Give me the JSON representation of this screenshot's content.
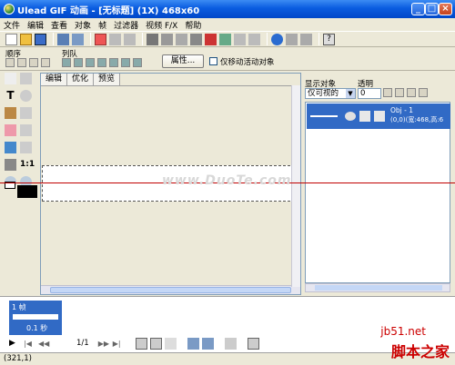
{
  "window": {
    "title": "Ulead GIF 动画 - [无标题] (1X) 468x60"
  },
  "menu": [
    "文件",
    "编辑",
    "查看",
    "对象",
    "帧",
    "过滤器",
    "视频 F/X",
    "帮助"
  ],
  "toolbar2": {
    "order_label": "顺序",
    "queue_label": "列队",
    "properties_button": "属性...",
    "move_active_only": "仅移动活动对象"
  },
  "canvas_tabs": [
    "编辑",
    "优化",
    "预览"
  ],
  "watermark": "www.DuoTe.com",
  "object_panel": {
    "show_label": "显示对象",
    "transparency_label": "透明",
    "show_select_value": "仅可视的",
    "transparency_value": "0",
    "object": {
      "name": "Obj - 1",
      "detail": "(0,0)(宽:468,高:6"
    }
  },
  "frames": {
    "frame_label": "1 帧",
    "delay_label": "0.1 秒",
    "page_counter": "1/1"
  },
  "status": {
    "coords": "(321,1)"
  },
  "watermark2": {
    "site": "jb51.net",
    "name": "脚本之家"
  },
  "colors": {
    "accent": "#316ac5",
    "title": "#0a5ce0",
    "red_guide": "#c00000"
  }
}
